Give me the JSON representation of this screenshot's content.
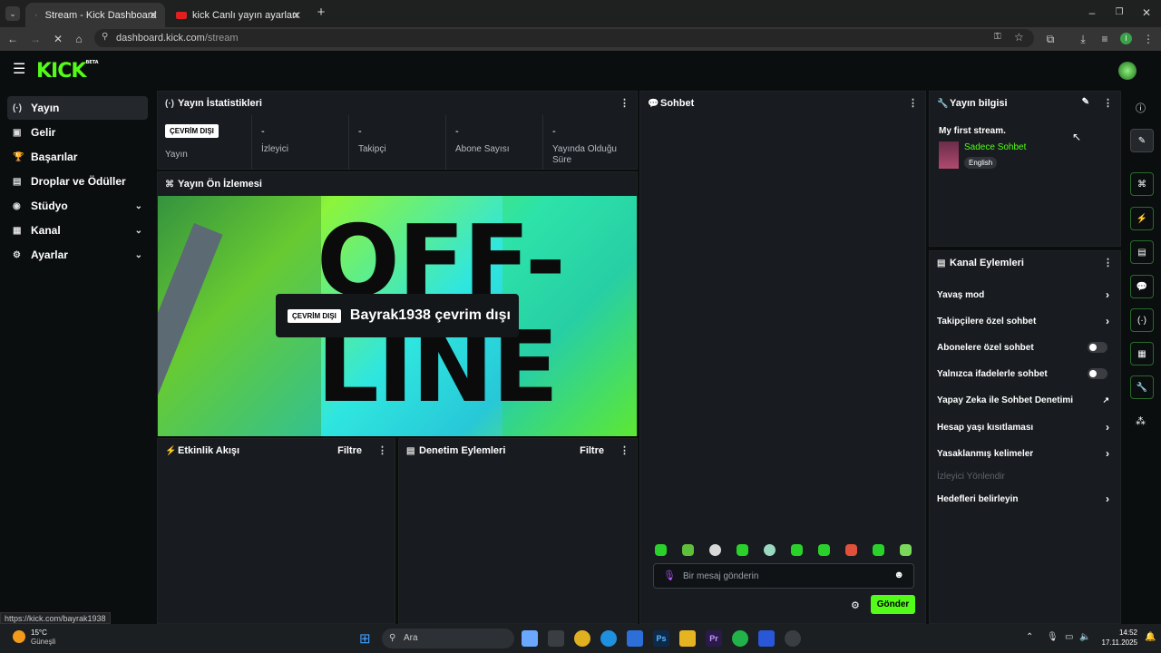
{
  "browser": {
    "tabs": [
      {
        "title": "Stream - Kick Dashboard",
        "close": "✕"
      },
      {
        "title": "kick Canlı yayın ayarları Ve yay…",
        "close": "✕"
      }
    ],
    "new_tab": "+",
    "url_host": "dashboard.kick.com",
    "url_path": "/stream",
    "profile_initial": "I",
    "status_url": "https://kick.com/bayrak1938"
  },
  "nav": {
    "logo": "KICK",
    "logo_beta": "BETA",
    "items": [
      {
        "label": "Yayın",
        "icon": "(·)"
      },
      {
        "label": "Gelir",
        "icon": "▣"
      },
      {
        "label": "Başarılar",
        "icon": "🏆"
      },
      {
        "label": "Droplar ve Ödüller",
        "icon": "▤"
      },
      {
        "label": "Stüdyo",
        "icon": "◉"
      },
      {
        "label": "Kanal",
        "icon": "▦"
      },
      {
        "label": "Ayarlar",
        "icon": "⚙"
      }
    ]
  },
  "stats": {
    "title": "Yayın İstatistikleri",
    "badge": "ÇEVRİM DIŞI",
    "broadcast_label": "Yayın",
    "items": [
      {
        "value": "-",
        "label": "İzleyici"
      },
      {
        "value": "-",
        "label": "Takipçi"
      },
      {
        "value": "-",
        "label": "Abone Sayısı"
      },
      {
        "value": "-",
        "label": "Yayında Olduğu Süre"
      }
    ]
  },
  "preview": {
    "title": "Yayın Ön İzlemesi",
    "badge": "ÇEVRİM DIŞI",
    "offline_text": "Bayrak1938 çevrim dışı",
    "bg_word_1": "OFF-",
    "bg_word_2": "LINE"
  },
  "activity": {
    "title": "Etkinlik Akışı",
    "filter": "Filtre"
  },
  "moderation": {
    "title": "Denetim Eylemleri",
    "filter": "Filtre"
  },
  "chat": {
    "title": "Sohbet",
    "placeholder": "Bir mesaj gönderin",
    "send": "Gönder"
  },
  "stream_info": {
    "title": "Yayın bilgisi",
    "stream_title": "My first stream.",
    "category": "Sadece Sohbet",
    "language": "English"
  },
  "channel_actions": {
    "title": "Kanal Eylemleri",
    "rows": [
      {
        "label": "Yavaş mod"
      },
      {
        "label": "Takipçilere özel sohbet"
      },
      {
        "label": "Abonelere özel sohbet"
      },
      {
        "label": "Yalnızca ifadelerle sohbet"
      },
      {
        "label": "Yapay Zeka ile Sohbet Denetimi"
      },
      {
        "label": "Hesap yaşı kısıtlaması"
      },
      {
        "label": "Yasaklanmış kelimeler"
      },
      {
        "label": "İzleyici Yönlendir"
      },
      {
        "label": "Hedefleri belirleyin"
      }
    ]
  },
  "taskbar": {
    "weather_temp": "15°C",
    "weather_desc": "Güneşli",
    "search": "Ara",
    "time": "14:52",
    "date": "17.11.2025",
    "app_ps": "Ps",
    "app_pr": "Pr"
  },
  "colors": {
    "accent": "#53fc18",
    "panel": "#181b1f"
  }
}
